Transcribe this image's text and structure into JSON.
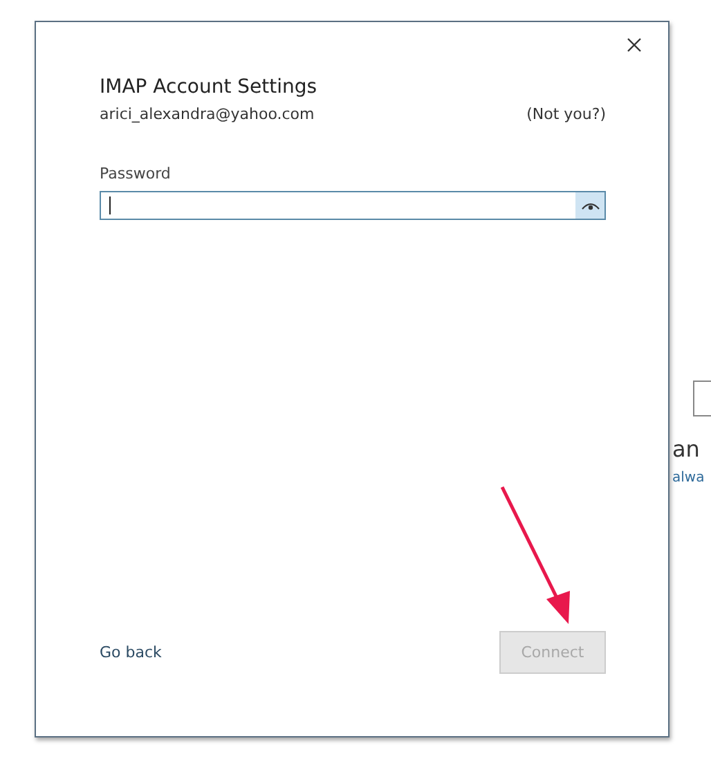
{
  "dialog": {
    "title": "IMAP Account Settings",
    "email": "arici_alexandra@yahoo.com",
    "not_you_link": "(Not you?)",
    "password": {
      "label": "Password",
      "focused": true
    },
    "go_back_link": "Go back",
    "connect_button": {
      "label": "Connect",
      "disabled": true
    }
  },
  "background": {
    "text": "an",
    "link": "alwa"
  }
}
